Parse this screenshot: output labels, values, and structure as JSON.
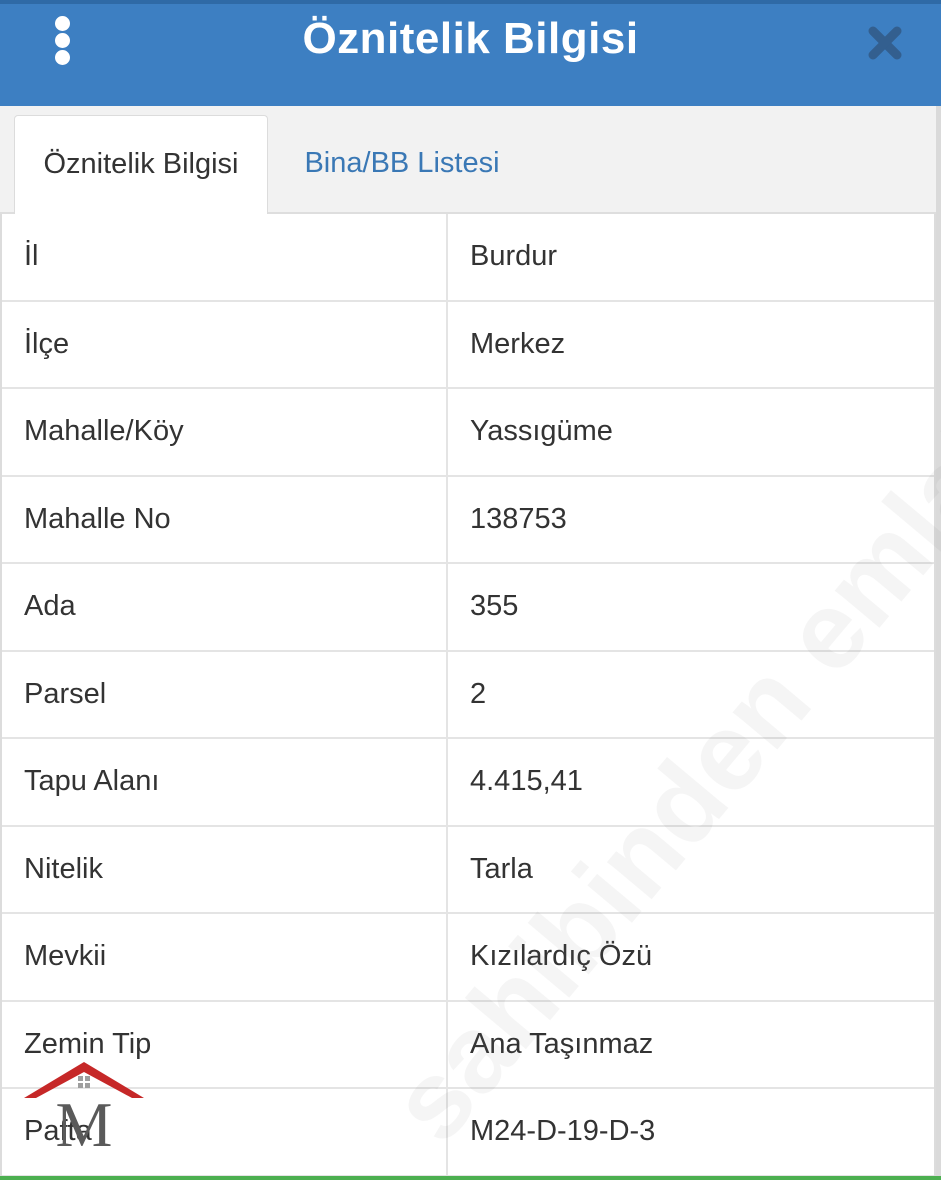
{
  "header": {
    "title": "Öznitelik Bilgisi",
    "menu_icon": "more-vertical-icon",
    "close_icon": "close-icon",
    "color": "#3d7fc2"
  },
  "tabs": [
    {
      "label": "Öznitelik Bilgisi",
      "active": true
    },
    {
      "label": "Bina/BB Listesi",
      "active": false
    }
  ],
  "rows": [
    {
      "label": "İl",
      "value": "Burdur"
    },
    {
      "label": "İlçe",
      "value": "Merkez"
    },
    {
      "label": "Mahalle/Köy",
      "value": "Yassıgüme"
    },
    {
      "label": "Mahalle No",
      "value": "138753"
    },
    {
      "label": "Ada",
      "value": "355"
    },
    {
      "label": "Parsel",
      "value": "2"
    },
    {
      "label": "Tapu Alanı",
      "value": "4.415,41"
    },
    {
      "label": "Nitelik",
      "value": "Tarla"
    },
    {
      "label": "Mevkii",
      "value": "Kızılardıç Özü"
    },
    {
      "label": "Zemin Tip",
      "value": "Ana Taşınmaz"
    },
    {
      "label": "Pafta",
      "value": "M24-D-19-D-3"
    }
  ],
  "watermark": "sahibinden emlakiet.com",
  "logo_text": "M"
}
